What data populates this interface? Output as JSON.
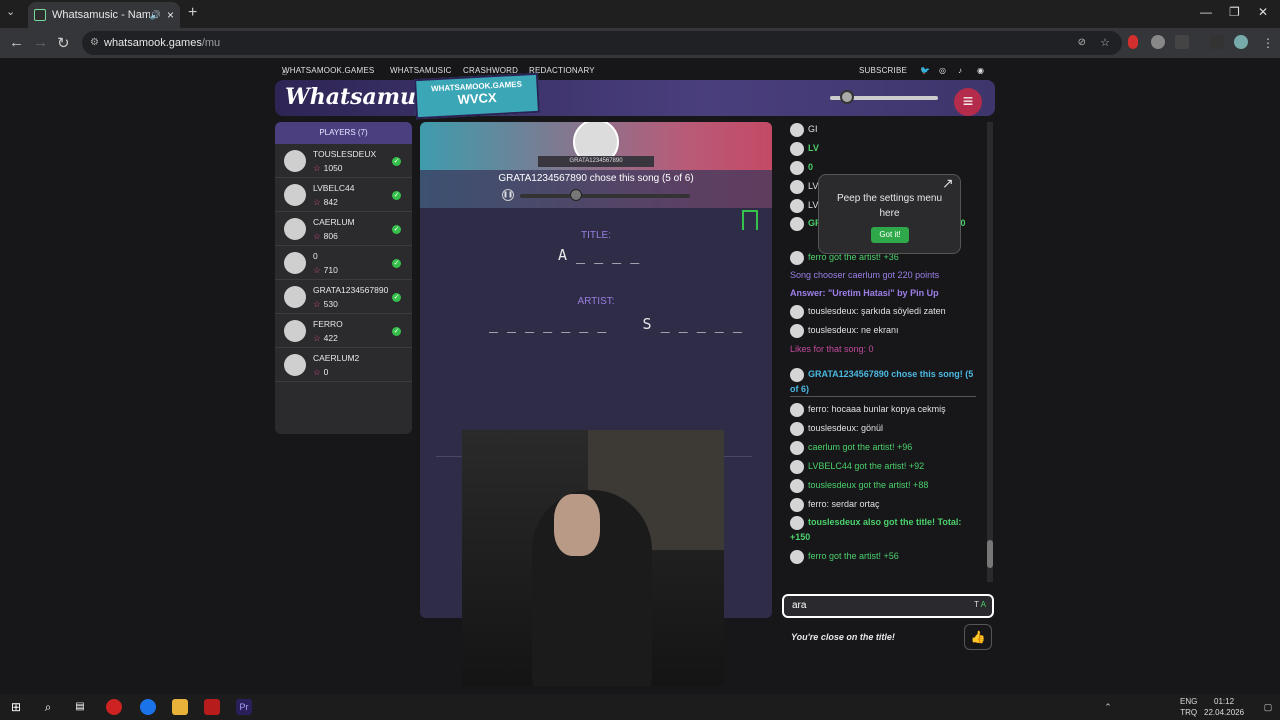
{
  "browser": {
    "tab_title": "Whatsamusic - Name That",
    "url_host": "whatsamook.games",
    "url_path": "/mu"
  },
  "site_nav": {
    "home": "WHATSAMOOK.GAMES",
    "whatsamusic": "WHATSAMUSIC",
    "crashword": "CRASHWORD",
    "redactionary": "REDACTIONARY",
    "subscribe": "SUBSCRIBE"
  },
  "header": {
    "logo": "Whatsamusic",
    "room_site": "WHATSAMOOK.GAMES",
    "room_code": "WVCX"
  },
  "players": {
    "title": "PLAYERS (7)",
    "list": [
      {
        "name": "TOUSLESDEUX",
        "score": "1050",
        "guessed": true
      },
      {
        "name": "LVBELC44",
        "score": "842",
        "guessed": true
      },
      {
        "name": "CAERLUM",
        "score": "806",
        "guessed": true
      },
      {
        "name": "0",
        "score": "710",
        "guessed": true
      },
      {
        "name": "GRATA1234567890",
        "score": "530",
        "guessed": true
      },
      {
        "name": "FERRO",
        "score": "422",
        "guessed": true
      },
      {
        "name": "CAERLUM2",
        "score": "0",
        "guessed": false
      }
    ]
  },
  "game": {
    "chooser_tag": "GRATA1234567890",
    "chose_text": "GRATA1234567890 chose this song (5 of 6)",
    "title_label": "TITLE:",
    "title_hint": "A _ _ _ _",
    "artist_label": "ARTIST:",
    "artist_hint": "_ _ _ _ _ _ _    S _ _ _ _ _"
  },
  "tooltip": {
    "text": "Peep the settings menu here",
    "button": "Got it!"
  },
  "chat": {
    "messages": [
      {
        "text": "GI",
        "style": ""
      },
      {
        "text": "LV",
        "style": "bgreen"
      },
      {
        "text": "0",
        "style": "bgreen"
      },
      {
        "text": "LV",
        "style": ""
      },
      {
        "text": "LVBELC44: lowlar",
        "style": ""
      },
      {
        "text": "GRATA1234567890 got the title! +120",
        "style": "bgreen"
      },
      {
        "text": "ferro got the artist! +36",
        "style": "green"
      },
      {
        "text": "Song chooser caerlum got 220 points",
        "style": "purple"
      },
      {
        "text": "Answer: \"Uretim Hatasi\" by Pin Up",
        "style": "bpurple"
      },
      {
        "text": "touslesdeux: şarkıda söyledi zaten",
        "style": ""
      },
      {
        "text": "touslesdeux: ne ekranı",
        "style": ""
      },
      {
        "text": "Likes for that song: 0",
        "style": "pink"
      },
      {
        "text": "GRATA1234567890 chose this song! (5 of 6)",
        "style": "blue"
      },
      {
        "text": "ferro: hocaaa bunlar kopya cekmiş",
        "style": ""
      },
      {
        "text": "touslesdeux: gönül",
        "style": ""
      },
      {
        "text": "caerlum got the artist! +96",
        "style": "green"
      },
      {
        "text": "LVBELC44 got the artist! +92",
        "style": "green"
      },
      {
        "text": "touslesdeux got the artist! +88",
        "style": "green"
      },
      {
        "text": "ferro: serdar ortaç",
        "style": ""
      },
      {
        "text": "touslesdeux also got the title! Total: +150",
        "style": "bgreen"
      },
      {
        "text": "ferro got the artist! +56",
        "style": "green"
      }
    ],
    "close_hint": "You're close on the title!",
    "input_value": "ara"
  },
  "taskbar": {
    "lang": "ENG",
    "region": "TRQ",
    "time": "01:12",
    "date": "22.04.2026"
  }
}
